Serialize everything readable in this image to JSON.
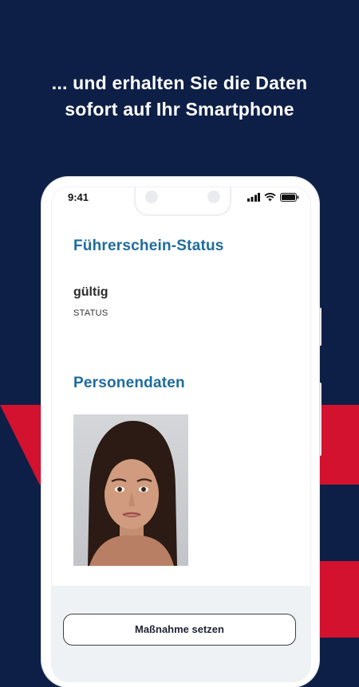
{
  "promo": {
    "headline_line1": "... und erhalten Sie die Daten",
    "headline_line2": "sofort auf Ihr Smartphone"
  },
  "colors": {
    "background": "#0e1f47",
    "accent_red": "#d2122e",
    "title_blue": "#1d6c9c"
  },
  "status_bar": {
    "time": "9:41",
    "icons": [
      "signal-icon",
      "wifi-icon",
      "battery-icon"
    ]
  },
  "license_status": {
    "section_title": "Führerschein-Status",
    "value": "gültig",
    "label": "STATUS"
  },
  "personal_data": {
    "section_title": "Personendaten",
    "photo": "portrait-photo"
  },
  "actions": {
    "primary_label": "Maßnahme setzen"
  }
}
